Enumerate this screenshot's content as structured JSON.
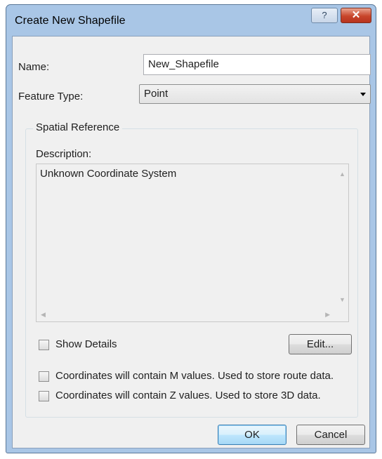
{
  "window": {
    "title": "Create New Shapefile",
    "help_glyph": "?",
    "close_glyph": "✕"
  },
  "name": {
    "label": "Name:",
    "value": "New_Shapefile"
  },
  "feature_type": {
    "label": "Feature Type:",
    "value": "Point"
  },
  "spatial_reference": {
    "group_label": "Spatial Reference",
    "description_label": "Description:",
    "description_text": "Unknown Coordinate System",
    "show_details_label": "Show Details",
    "show_details_checked": false,
    "edit_label": "Edit..."
  },
  "options": {
    "m_values_label": "Coordinates will contain M values. Used to store route data.",
    "m_values_checked": false,
    "z_values_label": "Coordinates will contain Z values. Used to store 3D data.",
    "z_values_checked": false
  },
  "footer": {
    "ok_label": "OK",
    "cancel_label": "Cancel"
  },
  "icons": {
    "help": "help-icon",
    "close": "close-icon",
    "dropdown": "chevron-down-icon",
    "scroll_up": "arrow-up-icon",
    "scroll_down": "arrow-down-icon",
    "scroll_left": "arrow-left-icon",
    "scroll_right": "arrow-right-icon"
  },
  "colors": {
    "frame": "#a9c6e6",
    "client": "#f0f0f0",
    "close_button": "#c8452b",
    "default_button_border": "#3c7fb1"
  }
}
